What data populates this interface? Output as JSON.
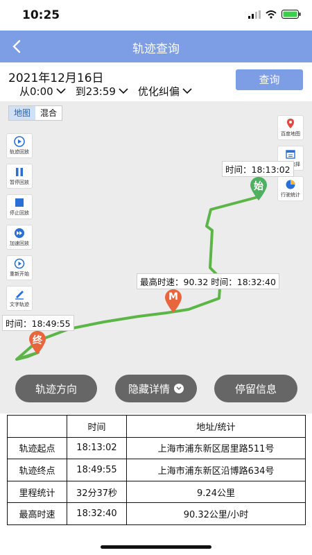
{
  "status_bar": {
    "time": "10:25"
  },
  "header": {
    "title": "轨迹查询"
  },
  "query": {
    "date": "2021年12月16日",
    "from": "从0:00",
    "to": "到23:59",
    "optimize": "优化纠偏",
    "query_button": "查询"
  },
  "map": {
    "toggle": [
      "地图",
      "混合"
    ],
    "left_controls": [
      {
        "label": "轨迹回放",
        "icon": "playback-icon"
      },
      {
        "label": "暂停回放",
        "icon": "pause-icon"
      },
      {
        "label": "停止回放",
        "icon": "stop-icon"
      },
      {
        "label": "加速回放",
        "icon": "fast-forward-icon"
      },
      {
        "label": "重新开始",
        "icon": "restart-icon"
      },
      {
        "label": "文字轨迹",
        "icon": "text-track-icon"
      }
    ],
    "right_controls": [
      {
        "label": "百度地图",
        "icon": "baidu-map-icon"
      },
      {
        "label": "日期选择",
        "icon": "calendar-icon"
      },
      {
        "label": "行驶统计",
        "icon": "pie-chart-icon"
      }
    ],
    "tooltips": {
      "start": "时间：18:13:02",
      "max_speed": "最高时速：90.32 时间：18:32:40",
      "end": "时间：18:49:55"
    },
    "markers": {
      "start": "始",
      "max": "M",
      "end": "终"
    },
    "route_color": "#5cb547"
  },
  "actions": {
    "direction": "轨迹方向",
    "hide_details": "隐藏详情",
    "stop_info": "停留信息"
  },
  "table": {
    "headers": [
      "",
      "时间",
      "地址/统计"
    ],
    "rows": [
      [
        "轨迹起点",
        "18:13:02",
        "上海市浦东新区居里路511号"
      ],
      [
        "轨迹终点",
        "18:49:55",
        "上海市浦东新区沿博路634号"
      ],
      [
        "里程统计",
        "32分37秒",
        "9.24公里"
      ],
      [
        "最高时速",
        "18:32:40",
        "90.32公里/小时"
      ]
    ]
  },
  "colors": {
    "accent": "#7d9de4",
    "marker": "#e8663d",
    "start_marker": "#4fb061"
  }
}
